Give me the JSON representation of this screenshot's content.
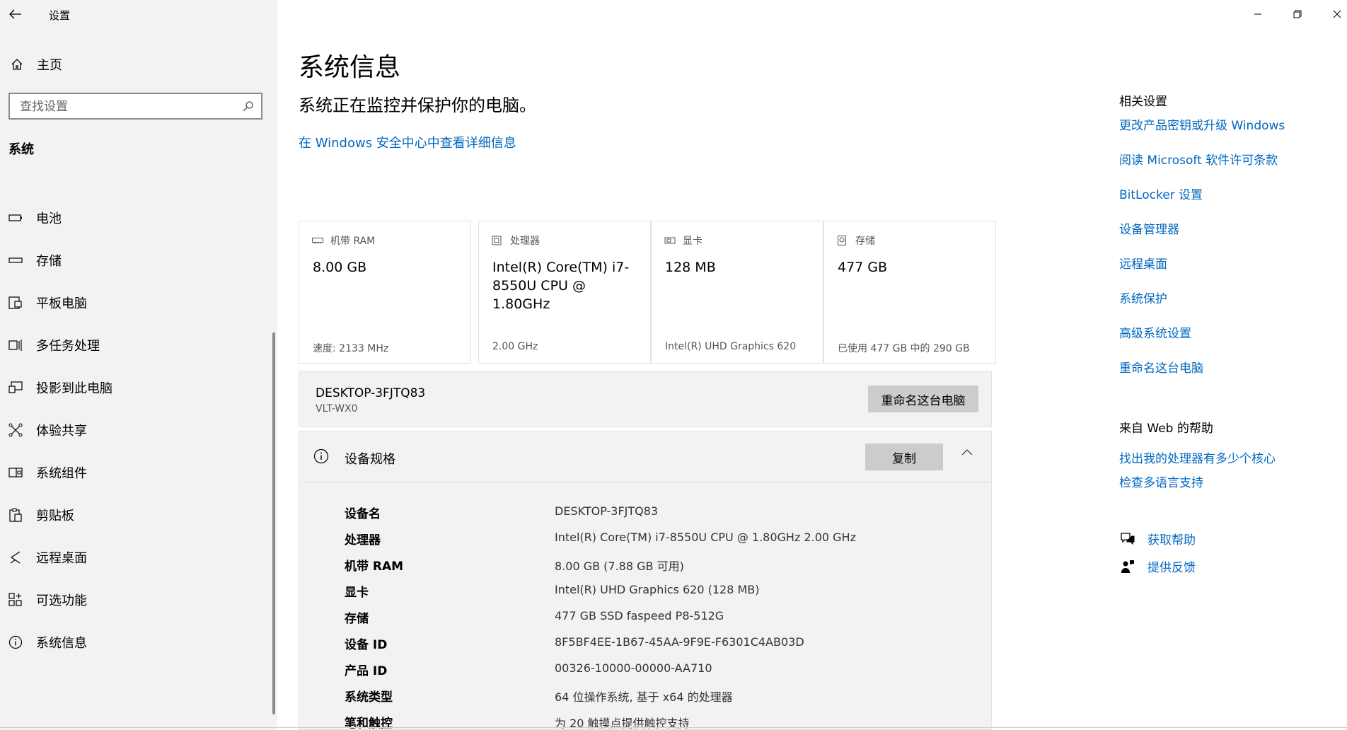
{
  "app": {
    "title": "设置"
  },
  "sidebar": {
    "home_label": "主页",
    "search_placeholder": "查找设置",
    "section_title": "系统",
    "items": [
      {
        "label": "电池",
        "icon": "battery-icon"
      },
      {
        "label": "存储",
        "icon": "storage-icon"
      },
      {
        "label": "平板电脑",
        "icon": "tablet-icon"
      },
      {
        "label": "多任务处理",
        "icon": "multitasking-icon"
      },
      {
        "label": "投影到此电脑",
        "icon": "project-icon"
      },
      {
        "label": "体验共享",
        "icon": "shared-experiences-icon"
      },
      {
        "label": "系统组件",
        "icon": "system-components-icon"
      },
      {
        "label": "剪贴板",
        "icon": "clipboard-icon"
      },
      {
        "label": "远程桌面",
        "icon": "remote-desktop-icon"
      },
      {
        "label": "可选功能",
        "icon": "optional-features-icon"
      },
      {
        "label": "系统信息",
        "icon": "info-icon"
      }
    ]
  },
  "main": {
    "title": "系统信息",
    "status": "系统正在监控并保护你的电脑。",
    "security_link": "在 Windows 安全中心中查看详细信息",
    "cards": [
      {
        "header": "机带 RAM",
        "icon": "ram-icon",
        "value": "8.00 GB",
        "sub": "速度: 2133 MHz"
      },
      {
        "header": "处理器",
        "icon": "cpu-icon",
        "value": "Intel(R) Core(TM) i7-8550U CPU @ 1.80GHz",
        "sub": "2.00 GHz"
      },
      {
        "header": "显卡",
        "icon": "gpu-icon",
        "value": "128 MB",
        "sub": "Intel(R) UHD Graphics 620"
      },
      {
        "header": "存储",
        "icon": "disk-icon",
        "value": "477 GB",
        "sub": "已使用 477 GB 中的 290 GB"
      }
    ],
    "device": {
      "name": "DESKTOP-3FJTQ83",
      "sub": "VLT-WX0",
      "rename_label": "重命名这台电脑"
    },
    "specs": {
      "title": "设备规格",
      "copy_label": "复制",
      "rows": [
        {
          "key": "设备名",
          "value": "DESKTOP-3FJTQ83"
        },
        {
          "key": "处理器",
          "value": "Intel(R) Core(TM) i7-8550U CPU @ 1.80GHz   2.00 GHz"
        },
        {
          "key": "机带 RAM",
          "value": "8.00 GB (7.88 GB 可用)"
        },
        {
          "key": "显卡",
          "value": "Intel(R) UHD Graphics 620 (128 MB)"
        },
        {
          "key": "存储",
          "value": "477 GB SSD faspeed P8-512G"
        },
        {
          "key": "设备 ID",
          "value": "8F5BF4EE-1B67-45AA-9F9E-F6301C4AB03D"
        },
        {
          "key": "产品 ID",
          "value": "00326-10000-00000-AA710"
        },
        {
          "key": "系统类型",
          "value": "64 位操作系统, 基于 x64 的处理器"
        },
        {
          "key": "笔和触控",
          "value": "为 20 触摸点提供触控支持"
        }
      ]
    }
  },
  "related": {
    "heading": "相关设置",
    "links": [
      "更改产品密钥或升级 Windows",
      "阅读 Microsoft 软件许可条款",
      "BitLocker 设置",
      "设备管理器",
      "远程桌面",
      "系统保护",
      "高级系统设置",
      "重命名这台电脑"
    ],
    "web_heading": "来自 Web 的帮助",
    "web_links": [
      "找出我的处理器有多少个核心",
      "检查多语言支持"
    ],
    "help": {
      "label": "获取帮助",
      "icon": "get-help-icon"
    },
    "feedback": {
      "label": "提供反馈",
      "icon": "feedback-icon"
    }
  },
  "colors": {
    "accent": "#0067c0",
    "sidebar_bg": "#f2f2f2",
    "button_bg": "#cccccc"
  }
}
